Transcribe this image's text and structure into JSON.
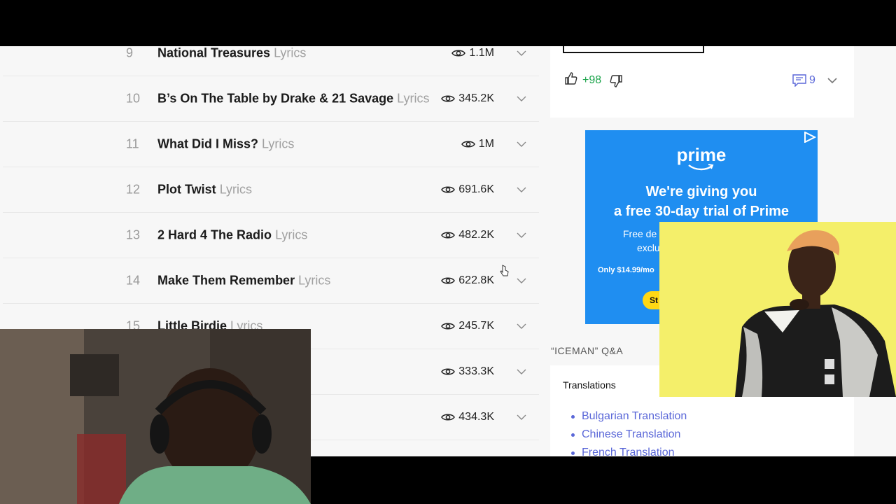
{
  "tracklist": {
    "suffix": "Lyrics",
    "tracks": [
      {
        "num": "9",
        "title": "National Treasures",
        "views": "1.1M",
        "show_title": true
      },
      {
        "num": "10",
        "title": "B’s On The Table by Drake & 21 Savage",
        "views": "345.2K",
        "show_title": true
      },
      {
        "num": "11",
        "title": "What Did I Miss?",
        "views": "1M",
        "show_title": true
      },
      {
        "num": "12",
        "title": "Plot Twist",
        "views": "691.6K",
        "show_title": true
      },
      {
        "num": "13",
        "title": "2 Hard 4 The Radio",
        "views": "482.2K",
        "show_title": true
      },
      {
        "num": "14",
        "title": "Make Them Remember",
        "views": "622.8K",
        "show_title": true
      },
      {
        "num": "15",
        "title": "Little Birdie",
        "views": "245.7K",
        "show_title": true
      },
      {
        "num": "",
        "title": "",
        "views": "333.3K",
        "show_title": false
      },
      {
        "num": "",
        "title": "",
        "views": "434.3K",
        "show_title": false
      }
    ]
  },
  "votes": {
    "count": "+98"
  },
  "comments": {
    "count": "9"
  },
  "ad": {
    "brand": "prime",
    "headline_line1": "We're giving you",
    "headline_line2": "a free 30-day trial of Prime",
    "sub_line1": "Free de",
    "sub_line2": "exclu",
    "price": "Only $14.99/mo",
    "cta": "St"
  },
  "qa": {
    "heading": "“ICEMAN” Q&A",
    "tab": "Translations",
    "items": [
      "Bulgarian Translation",
      "Chinese Translation",
      "French Translation"
    ]
  },
  "colors": {
    "views_link": "#5a67d8",
    "vote_green": "#1aa34a",
    "ad_blue": "#1f8ef1",
    "overlay_yellow": "#f4ef6a"
  }
}
